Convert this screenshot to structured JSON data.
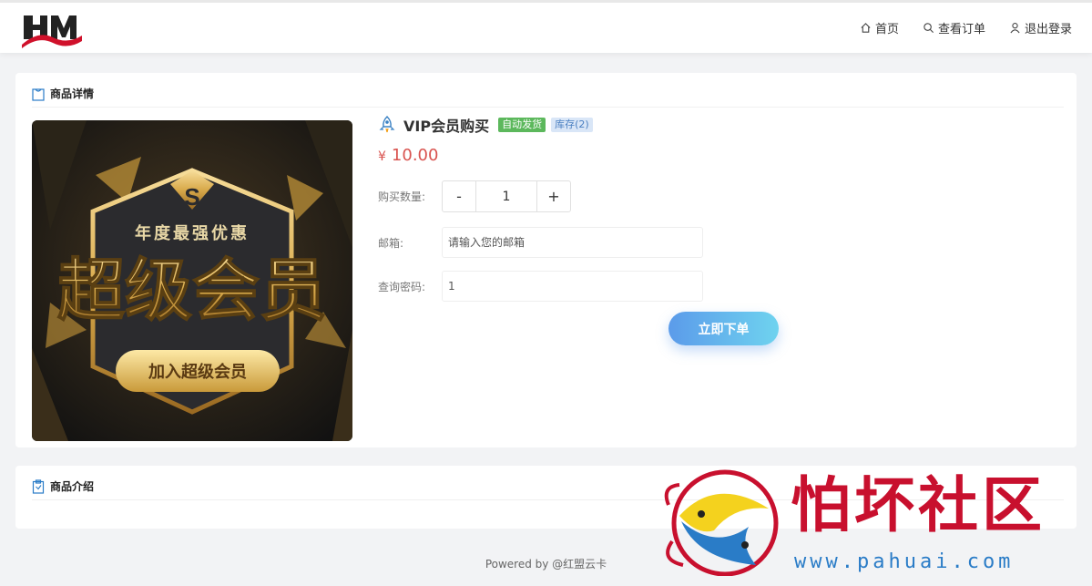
{
  "nav": {
    "home": "首页",
    "orders": "查看订单",
    "logout": "退出登录"
  },
  "detail": {
    "section_title": "商品详情",
    "product_name": "VIP会员购买",
    "badge_auto": "自动发货",
    "badge_stock": "库存(2)",
    "currency": "¥",
    "price": "10.00",
    "qty_label": "购买数量:",
    "qty_minus": "-",
    "qty_value": "1",
    "qty_plus": "+",
    "email_label": "邮箱:",
    "email_placeholder": "请输入您的邮箱",
    "pwd_label": "查询密码:",
    "pwd_value": "1",
    "submit_label": "立即下单"
  },
  "product_image": {
    "line1": "年度最强优惠",
    "line2": "超级会员",
    "line3": "加入超级会员"
  },
  "intro": {
    "section_title": "商品介绍"
  },
  "footer": {
    "text": "Powered by @红盟云卡"
  },
  "watermark": {
    "title": "怕坏社区",
    "url": "www.pahuai.com"
  },
  "colors": {
    "price": "#d9534f",
    "badge_auto": "#5cb85c",
    "badge_stock_bg": "#d9e6f7",
    "submit_start": "#5b9bea",
    "submit_end": "#6fd3ef",
    "watermark_red": "#c8102e",
    "watermark_blue": "#2a7cc7"
  }
}
